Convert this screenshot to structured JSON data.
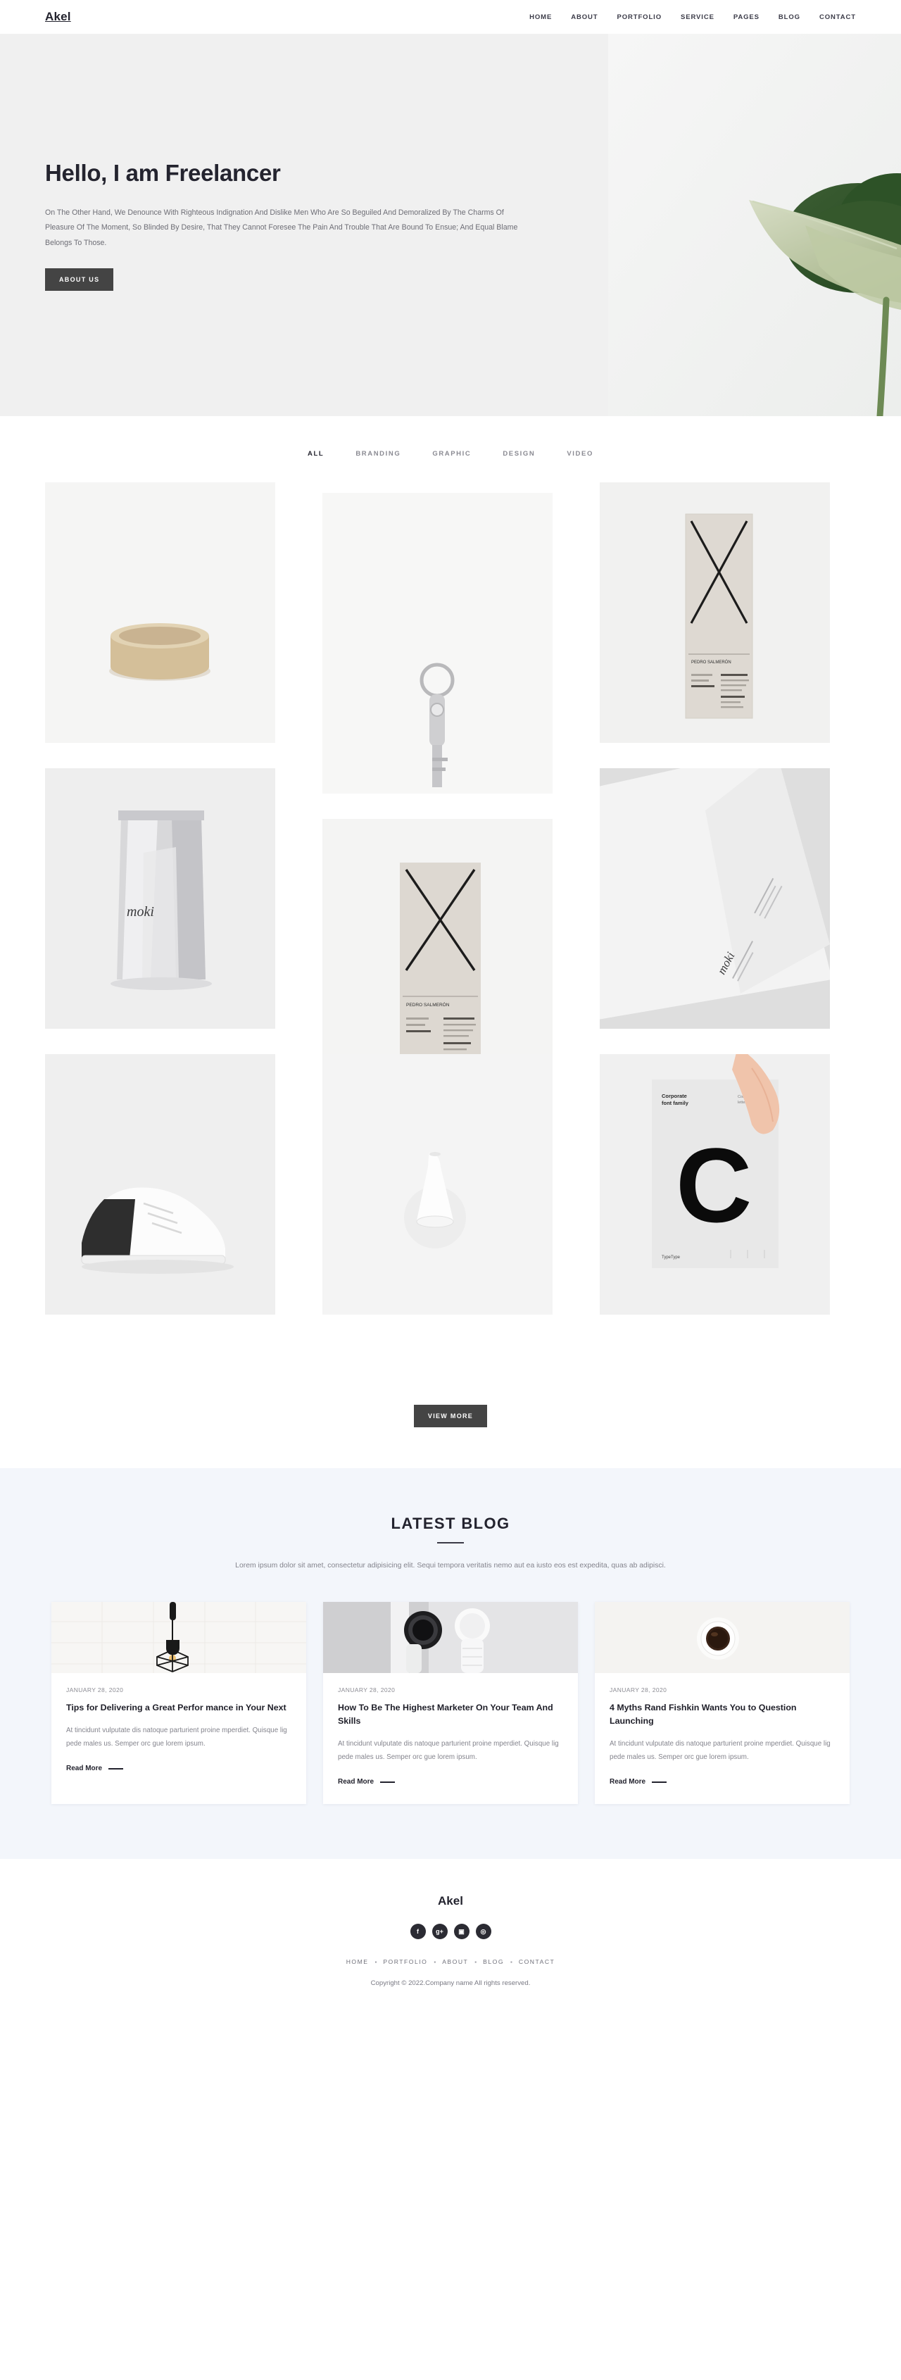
{
  "header": {
    "brand": "Akel",
    "nav": [
      {
        "label": "HOME"
      },
      {
        "label": "ABOUT"
      },
      {
        "label": "PORTFOLIO"
      },
      {
        "label": "SERVICE"
      },
      {
        "label": "PAGES"
      },
      {
        "label": "BLOG"
      },
      {
        "label": "CONTACT"
      }
    ]
  },
  "hero": {
    "title": "Hello, I am Freelancer",
    "description": "On The Other Hand, We Denounce With Righteous Indignation And Dislike Men Who Are So Beguiled And Demoralized By The Charms Of Pleasure Of The Moment, So Blinded By Desire, That They Cannot Foresee The Pain And Trouble That Are Bound To Ensue; And Equal Blame Belongs To Those.",
    "cta_label": "ABOUT US",
    "background_color": "#f0f0f0",
    "photo_alt": "monstera-plant-photo"
  },
  "portfolio": {
    "filters": [
      {
        "label": "ALL",
        "active": true
      },
      {
        "label": "BRANDING",
        "active": false
      },
      {
        "label": "GRAPHIC",
        "active": false
      },
      {
        "label": "DESIGN",
        "active": false
      },
      {
        "label": "VIDEO",
        "active": false
      }
    ],
    "items": [
      {
        "name": "ceramic-bowl"
      },
      {
        "name": "key-on-keyring"
      },
      {
        "name": "brochure-cover-x"
      },
      {
        "name": "foil-pouch-packaging"
      },
      {
        "name": "poster-cover-x"
      },
      {
        "name": "tilted-letterhead"
      },
      {
        "name": "white-sneaker"
      },
      {
        "name": "table-lamp"
      },
      {
        "name": "typography-poster-c"
      }
    ],
    "view_more_label": "VIEW MORE"
  },
  "blog": {
    "title": "LATEST BLOG",
    "subtitle": "Lorem ipsum dolor sit amet, consectetur adipisicing elit. Sequi tempora veritatis nemo aut ea iusto eos est expedita, quas ab adipisci.",
    "background_color": "#f3f6fb",
    "posts": [
      {
        "date": "JANUARY 28, 2020",
        "title": "Tips for Delivering a Great Perfor mance in Your Next",
        "excerpt": "At tincidunt vulputate dis natoque parturient proine mperdiet. Quisque lig pede males us. Semper orc gue lorem ipsum.",
        "read_more": "Read More",
        "image_alt": "pendant-lamp-photo"
      },
      {
        "date": "JANUARY 28, 2020",
        "title": "How To Be The Highest Marketer On Your Team And Skills",
        "excerpt": "At tincidunt vulputate dis natoque parturient proine mperdiet. Quisque lig pede males us. Semper orc gue lorem ipsum.",
        "read_more": "Read More",
        "image_alt": "smartwatches-photo"
      },
      {
        "date": "JANUARY 28, 2020",
        "title": "4 Myths Rand Fishkin Wants You to Question Launching",
        "excerpt": "At tincidunt vulputate dis natoque parturient proine mperdiet. Quisque lig pede males us. Semper orc gue lorem ipsum.",
        "read_more": "Read More",
        "image_alt": "coffee-cup-top-view-photo"
      }
    ]
  },
  "footer": {
    "brand": "Akel",
    "socials": [
      {
        "name": "facebook-icon",
        "glyph": "f"
      },
      {
        "name": "google-plus-icon",
        "glyph": "g+"
      },
      {
        "name": "instagram-icon",
        "glyph": "▣"
      },
      {
        "name": "dribbble-icon",
        "glyph": "◎"
      }
    ],
    "nav": [
      {
        "label": "HOME"
      },
      {
        "label": "PORTFOLIO"
      },
      {
        "label": "ABOUT"
      },
      {
        "label": "BLOG"
      },
      {
        "label": "CONTACT"
      }
    ],
    "separator": "▪",
    "copyright": "Copyright © 2022.Company name All rights reserved."
  }
}
